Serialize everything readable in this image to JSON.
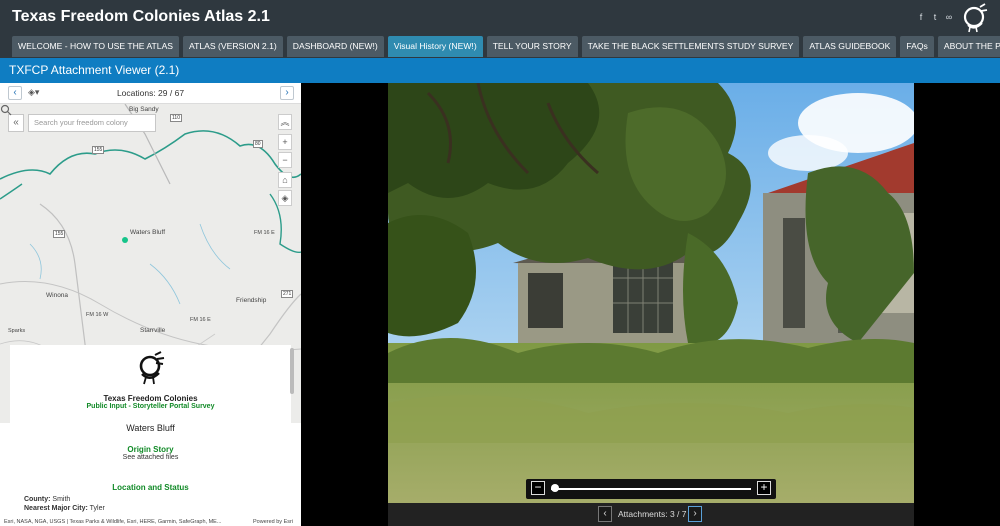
{
  "app": {
    "title": "Texas Freedom Colonies Atlas 2.1"
  },
  "social": {
    "icons": [
      "facebook-icon",
      "twitter-icon",
      "link-icon"
    ]
  },
  "tabs": [
    {
      "label": "WELCOME - HOW TO USE THE ATLAS"
    },
    {
      "label": "ATLAS (VERSION 2.1)"
    },
    {
      "label": "DASHBOARD (NEW!)"
    },
    {
      "label": "Visual History (NEW!)"
    },
    {
      "label": "TELL YOUR STORY"
    },
    {
      "label": "TAKE THE BLACK SETTLEMENTS STUDY SURVEY"
    },
    {
      "label": "ATLAS GUIDEBOOK"
    },
    {
      "label": "FAQs"
    },
    {
      "label": "ABOUT THE PROJECT"
    }
  ],
  "viewer": {
    "title": "TXFCP Attachment Viewer (2.1)"
  },
  "nav": {
    "locations": "Locations: 29 / 67",
    "prev": "‹",
    "next": "›"
  },
  "search": {
    "placeholder": "Search your freedom colony"
  },
  "map": {
    "labels": {
      "big_sandy": "Big Sandy",
      "waters_bluff": "Waters Bluff",
      "winona": "Winona",
      "friendship": "Friendship",
      "starrville": "Starrville",
      "fm_16": "FM 16 E",
      "fm_16b": "FM 16 E",
      "fm_16w": "FM 16 W",
      "sparks": "Sparks"
    },
    "highways": {
      "h155a": "155",
      "h155b": "155",
      "h80": "80",
      "h271": "271",
      "h110": "110"
    }
  },
  "info": {
    "org": "Texas Freedom Colonies",
    "survey": "Public Input - Storyteller Portal Survey",
    "place": "Waters Bluff",
    "origin_heading": "Origin Story",
    "origin_text": "See attached files",
    "location_heading": "Location and Status",
    "county_label": "County:",
    "county_value": "Smith",
    "city_label": "Nearest Major City:",
    "city_value": "Tyler"
  },
  "attribution": {
    "text": "Esri, NASA, NGA, USGS | Texas Parks & Wildlife, Esri, HERE, Garmin, SafeGraph, ME...",
    "powered": "Powered by Esri"
  },
  "attachments": {
    "count": "Attachments: 3 / 7"
  },
  "zoom": {
    "level": 0.0
  }
}
